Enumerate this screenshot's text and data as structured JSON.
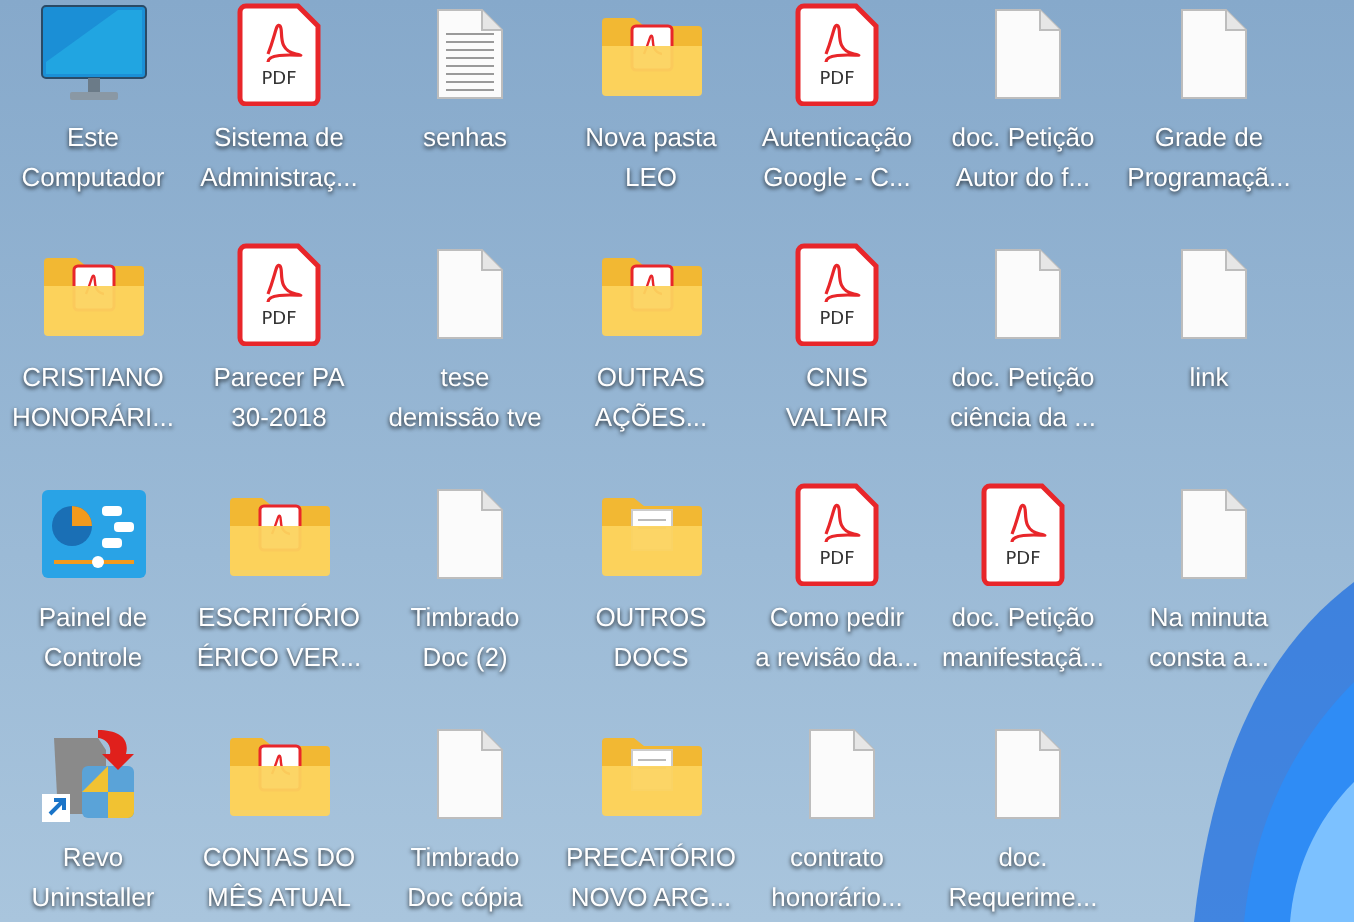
{
  "desktop_icons": [
    {
      "kind": "computer",
      "label": [
        "Este",
        "Computador"
      ]
    },
    {
      "kind": "pdf",
      "badge": "PDF",
      "label": [
        "Sistema de",
        "Administraç..."
      ]
    },
    {
      "kind": "text",
      "label": [
        "senhas"
      ]
    },
    {
      "kind": "folder-pdf",
      "label": [
        "Nova pasta",
        "LEO"
      ]
    },
    {
      "kind": "pdf",
      "badge": "PDF",
      "label": [
        "Autenticação",
        "Google - C..."
      ]
    },
    {
      "kind": "blank",
      "label": [
        "doc. Petição",
        "Autor do f..."
      ]
    },
    {
      "kind": "blank",
      "label": [
        "Grade de",
        "Programaçã..."
      ]
    },
    {
      "kind": "folder-pdf",
      "label": [
        "CRISTIANO",
        "HONORÁRI..."
      ]
    },
    {
      "kind": "pdf",
      "badge": "PDF",
      "label": [
        "Parecer PA",
        "30-2018"
      ]
    },
    {
      "kind": "blank",
      "label": [
        "tese",
        "demissão tve"
      ]
    },
    {
      "kind": "folder-pdf",
      "label": [
        "OUTRAS",
        "AÇÕES..."
      ]
    },
    {
      "kind": "pdf",
      "badge": "PDF",
      "label": [
        "CNIS",
        "VALTAIR"
      ]
    },
    {
      "kind": "blank",
      "label": [
        "doc. Petição",
        "ciência da ..."
      ]
    },
    {
      "kind": "blank",
      "label": [
        "link"
      ]
    },
    {
      "kind": "control-panel",
      "label": [
        "Painel de",
        "Controle"
      ]
    },
    {
      "kind": "folder-pdf",
      "label": [
        "ESCRITÓRIO",
        "ÉRICO VER..."
      ]
    },
    {
      "kind": "blank",
      "label": [
        "Timbrado",
        "Doc (2)"
      ]
    },
    {
      "kind": "folder-doc",
      "label": [
        "OUTROS",
        "DOCS"
      ]
    },
    {
      "kind": "pdf",
      "badge": "PDF",
      "label": [
        "Como pedir",
        "a revisão da..."
      ]
    },
    {
      "kind": "pdf",
      "badge": "PDF",
      "label": [
        "doc. Petição",
        "manifestaçã..."
      ]
    },
    {
      "kind": "blank",
      "label": [
        "Na minuta",
        "consta a..."
      ]
    },
    {
      "kind": "uninstaller",
      "label": [
        "Revo",
        "Uninstaller"
      ]
    },
    {
      "kind": "folder-pdf",
      "label": [
        "CONTAS DO",
        "MÊS ATUAL"
      ]
    },
    {
      "kind": "blank",
      "label": [
        "Timbrado",
        "Doc cópia"
      ]
    },
    {
      "kind": "folder-doc",
      "label": [
        "PRECATÓRIO",
        "NOVO ARG..."
      ]
    },
    {
      "kind": "blank",
      "label": [
        "contrato",
        "honorário..."
      ]
    },
    {
      "kind": "blank",
      "label": [
        "doc.",
        "Requerime..."
      ]
    }
  ]
}
